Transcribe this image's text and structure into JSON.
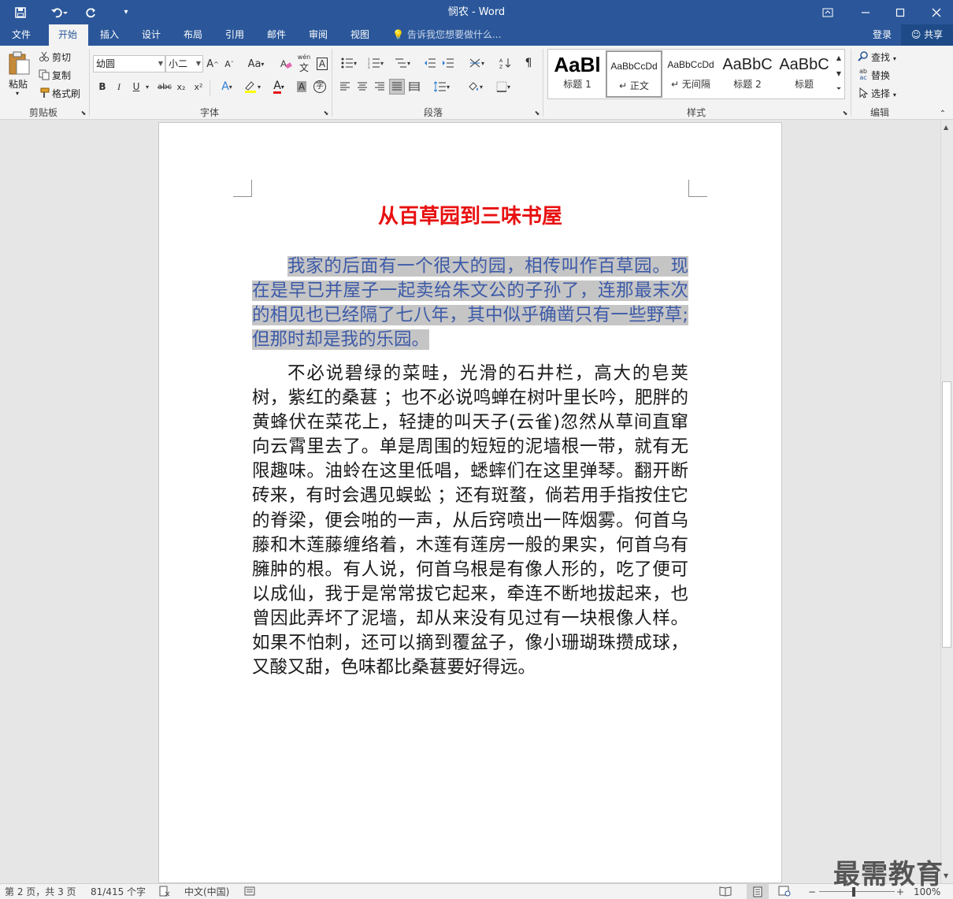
{
  "window": {
    "title": "悯农 - Word"
  },
  "qat": {
    "save": "save-icon",
    "undo": "undo-icon",
    "redo": "redo-icon",
    "customize": "customize-icon"
  },
  "tabs": [
    {
      "label": "文件"
    },
    {
      "label": "开始"
    },
    {
      "label": "插入"
    },
    {
      "label": "设计"
    },
    {
      "label": "布局"
    },
    {
      "label": "引用"
    },
    {
      "label": "邮件"
    },
    {
      "label": "审阅"
    },
    {
      "label": "视图"
    }
  ],
  "active_tab": "开始",
  "tellme": {
    "placeholder": "告诉我您想要做什么..."
  },
  "account": {
    "login": "登录",
    "share": "共享"
  },
  "clipboard": {
    "paste": "粘贴",
    "cut": "剪切",
    "copy": "复制",
    "format_painter": "格式刷",
    "group": "剪贴板"
  },
  "font": {
    "name": "幼圆",
    "size": "小二",
    "group": "字体",
    "case_label": "Aa",
    "pinyin_label": "wén",
    "bold": "B",
    "italic": "I",
    "underline": "U",
    "strike": "abc",
    "sub": "x₂",
    "sup": "x²",
    "text_effect": "A",
    "font_color": "A",
    "char_shading": "A",
    "enclose": "字",
    "border": "A"
  },
  "paragraph": {
    "group": "段落"
  },
  "styles": {
    "group": "样式",
    "items": [
      {
        "preview": "AaBl",
        "name": "标题 1"
      },
      {
        "preview": "AaBbCcDd",
        "name": "正文"
      },
      {
        "preview": "AaBbCcDd",
        "name": "无间隔"
      },
      {
        "preview": "AaBbC",
        "name": "标题 2"
      },
      {
        "preview": "AaBbC",
        "name": "标题"
      }
    ]
  },
  "editing": {
    "find": "查找",
    "replace": "替换",
    "select": "选择",
    "group": "编辑"
  },
  "document": {
    "title": "从百草园到三味书屋",
    "para1": "我家的后面有一个很大的园，相传叫作百草园。现在是早已并屋子一起卖给朱文公的子孙了，连那最末次的相见也已经隔了七八年，其中似乎确凿只有一些野草;但那时却是我的乐园。",
    "para2": "不必说碧绿的菜畦，光滑的石井栏，高大的皂荚树，紫红的桑葚 ；也不必说鸣蝉在树叶里长吟，肥胖的黄蜂伏在菜花上，轻捷的叫天子(云雀)忽然从草间直窜向云霄里去了。单是周围的短短的泥墙根一带，就有无限趣味。油蛉在这里低唱，蟋蟀们在这里弹琴。翻开断砖来，有时会遇见蜈蚣 ；还有斑蝥，倘若用手指按住它的脊梁，便会啪的一声，从后窍喷出一阵烟雾。何首乌藤和木莲藤缠络着，木莲有莲房一般的果实，何首乌有臃肿的根。有人说，何首乌根是有像人形的，吃了便可以成仙，我于是常常拔它起来，牵连不断地拔起来，也曾因此弄坏了泥墙，却从来没有见过有一块根像人样。如果不怕刺，还可以摘到覆盆子，像小珊瑚珠攒成球，又酸又甜，色味都比桑葚要好得远。"
  },
  "status": {
    "page": "第 2 页，共 3 页",
    "words": "81/415 个字",
    "language": "中文(中国)",
    "zoom": "100%",
    "zoom_minus": "−",
    "zoom_plus": "+"
  },
  "watermark": "最需教育",
  "colors": {
    "accent": "#2b579a",
    "title_red": "#e81010",
    "highlight": "#c5c5c5"
  }
}
